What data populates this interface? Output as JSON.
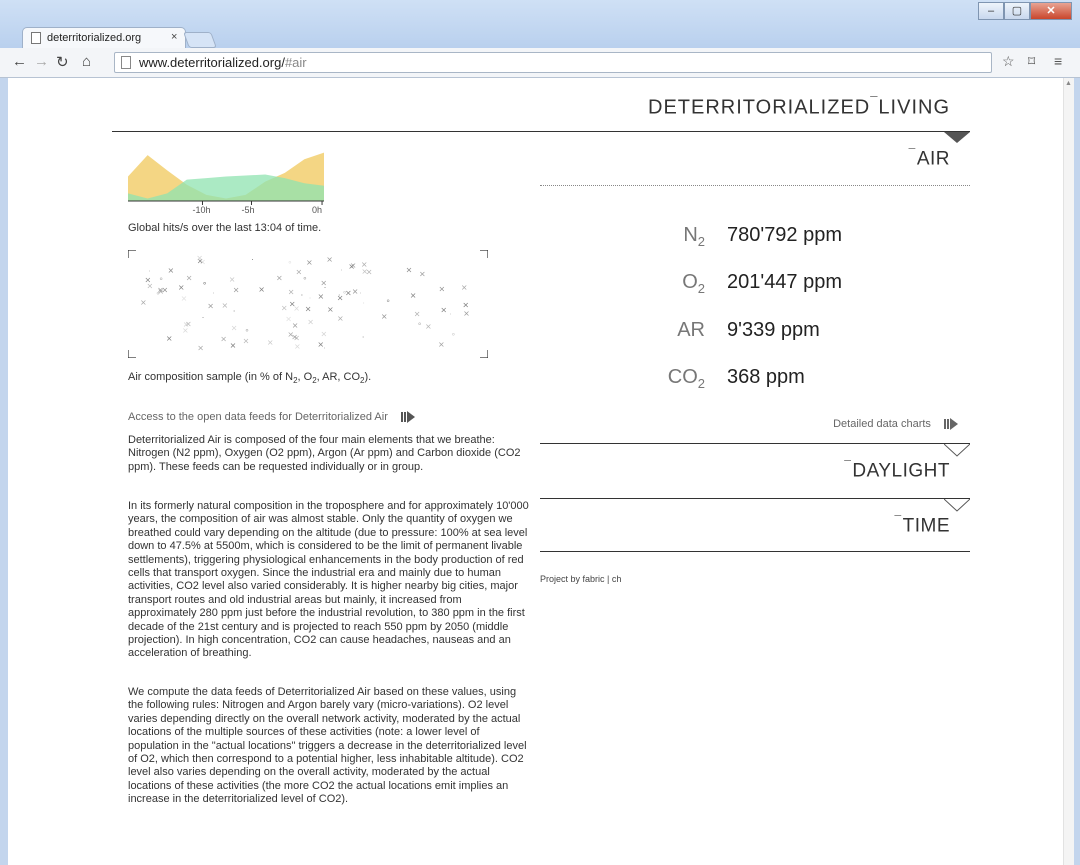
{
  "browser": {
    "tab_title": "deterritorialized.org",
    "tab_close": "×",
    "url_host": "www.deterritorialized.org/",
    "url_path": "#air"
  },
  "site": {
    "title": "DETERRITORIALIZED",
    "title_mark": "¯",
    "title_suffix": "LIVING"
  },
  "sections": {
    "air": {
      "mark": "¯",
      "label": "AIR"
    },
    "daylight": {
      "mark": "¯",
      "label": "DAYLIGHT"
    },
    "time": {
      "mark": "¯",
      "label": "TIME"
    }
  },
  "measures": [
    {
      "symbol": "N",
      "sub": "2",
      "value": "780'792 ppm"
    },
    {
      "symbol": "O",
      "sub": "2",
      "value": "201'447 ppm"
    },
    {
      "symbol": "AR",
      "sub": "",
      "value": "9'339 ppm"
    },
    {
      "symbol": "CO",
      "sub": "2",
      "value": "368 ppm"
    }
  ],
  "detailed_link": "Detailed data charts",
  "project_credit": "Project by fabric | ch",
  "chart_data": {
    "type": "area",
    "x_tick_labels": [
      "-10h",
      "-5h",
      "0h"
    ],
    "series": [
      {
        "color": "#f2cf6e",
        "values": [
          0.48,
          0.9,
          0.6,
          0.32,
          0.12,
          0.05,
          0.12,
          0.38,
          0.55,
          0.82,
          0.95
        ]
      },
      {
        "color": "#8fe3b0",
        "values": [
          0.15,
          0.05,
          0.15,
          0.42,
          0.45,
          0.48,
          0.5,
          0.52,
          0.45,
          0.35,
          0.3
        ]
      }
    ]
  },
  "hits_caption": "Global hits/s over the last 13:04 of time.",
  "sample_caption": {
    "prefix": "Air composition sample (in % of N",
    "sub1": "2",
    "mid1": ", O",
    "sub2": "2",
    "mid2": ", AR, CO",
    "sub3": "2",
    "suffix": ")."
  },
  "access_link": "Access to the open data feeds for Deterritorialized Air",
  "paragraphs": [
    "Deterritorialized Air is composed of the four main elements that we breathe: Nitrogen (N2 ppm), Oxygen (O2 ppm), Argon (Ar ppm) and Carbon dioxide (CO2 ppm). These feeds can be requested individually or in group.",
    "In its formerly natural composition in the troposphere and for approximately 10'000 years, the composition of air was almost stable. Only the quantity of oxygen we breathed could vary depending on the altitude (due to pressure: 100% at sea level down to 47.5% at 5500m, which is considered to be the limit of permanent livable settlements), triggering physiological enhancements in the body production of red cells that transport oxygen. Since the industrial era and mainly due to human activities, CO2 level also varied considerably. It is higher nearby big cities, major transport routes and old industrial areas but mainly, it increased from approximately 280 ppm just before the industrial revolution, to 380 ppm in the first decade of the 21st century and is projected to reach 550 ppm by 2050 (middle projection). In high concentration, CO2 can cause headaches, nauseas and an acceleration of breathing.",
    "We compute the data feeds of Deterritorialized Air based on these values, using the following rules: Nitrogen and Argon barely vary (micro-variations). O2 level varies depending directly on the overall network activity, moderated by the actual locations of the multiple sources of these activities (note: a lower level of population in the \"actual locations\" triggers a decrease in the deterritorialized level of O2, which then correspond to a potential higher, less inhabitable altitude). CO2 level also varies depending on the overall activity, moderated by the actual locations of these activities (the more CO2 the actual locations emit implies an increase in the deterritorialized level of CO2)."
  ]
}
